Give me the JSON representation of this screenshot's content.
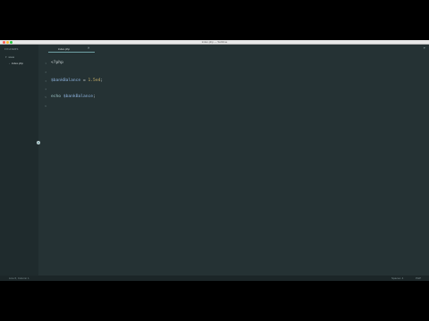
{
  "window": {
    "title": "index.php — Sublime"
  },
  "sidebar": {
    "header": "FOLDERS",
    "items": [
      {
        "label": "www",
        "icon": "folder-open-icon"
      },
      {
        "label": "index.php",
        "icon": "file-icon"
      }
    ]
  },
  "tabs": [
    {
      "label": "index.php",
      "active": true,
      "close": "×"
    }
  ],
  "tabbar": {
    "chevron": "▾"
  },
  "code": {
    "lines": [
      {
        "num": "1",
        "tokens": [
          [
            "tag",
            "<?php"
          ]
        ]
      },
      {
        "num": "2",
        "tokens": []
      },
      {
        "num": "3",
        "tokens": [
          [
            "var",
            "$bankBalance"
          ],
          [
            "op",
            " = "
          ],
          [
            "num",
            "1.5e4"
          ],
          [
            "op",
            ";"
          ]
        ]
      },
      {
        "num": "4",
        "tokens": []
      },
      {
        "num": "5",
        "tokens": [
          [
            "kw",
            "echo"
          ],
          [
            "op",
            " "
          ],
          [
            "var",
            "$bankBalance"
          ],
          [
            "op",
            ";"
          ]
        ]
      },
      {
        "num": "6",
        "tokens": []
      }
    ]
  },
  "statusbar": {
    "left": "Line 6, Column 1",
    "spaces": "Spaces: 4",
    "syntax": "PHP"
  },
  "colors": {
    "background": "#253234",
    "sidebar": "#1f2b2d",
    "accent": "#6fa0a4"
  }
}
